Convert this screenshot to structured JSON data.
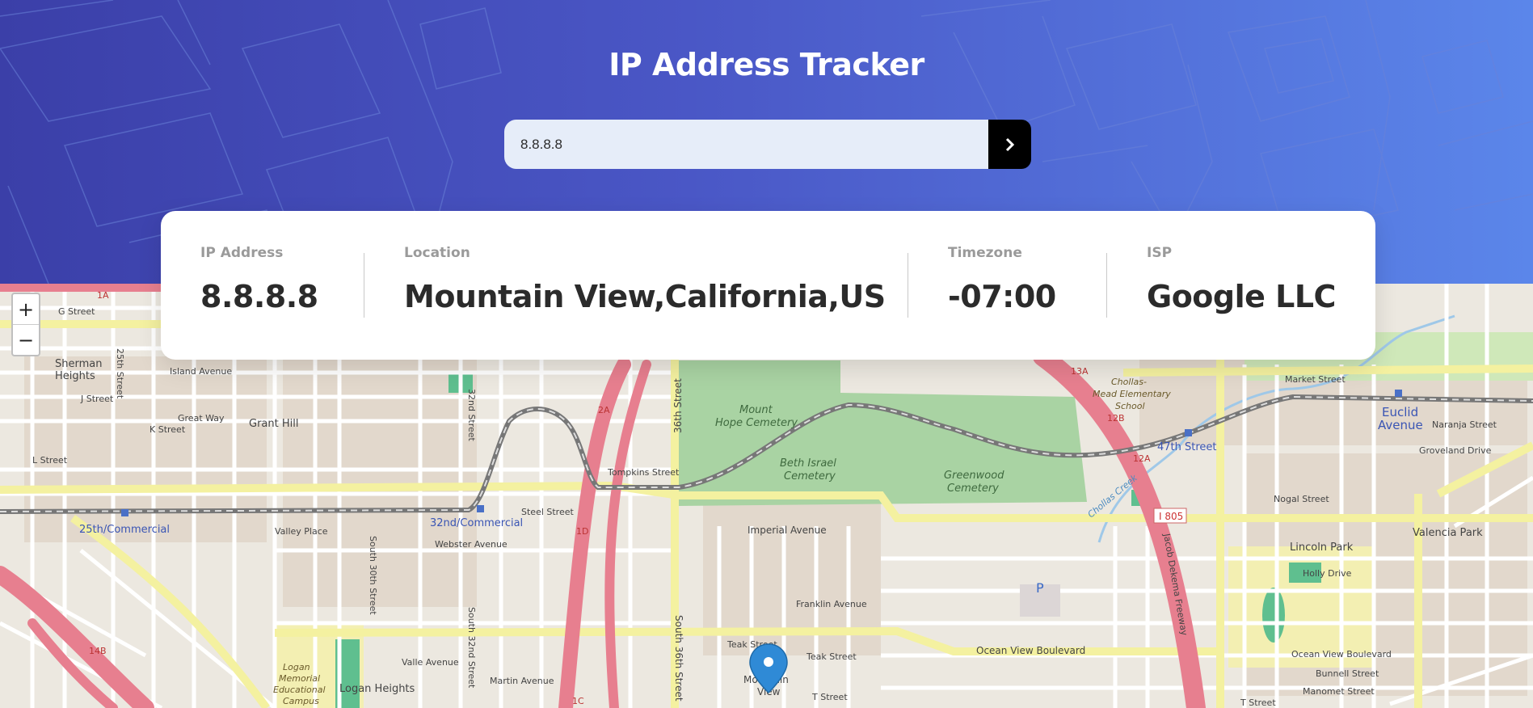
{
  "header": {
    "title": "IP Address Tracker",
    "search": {
      "value": "8.8.8.8"
    },
    "submit_icon": "chevron-right-icon"
  },
  "info": {
    "ip": {
      "label": "IP Address",
      "value": "8.8.8.8"
    },
    "location": {
      "label": "Location",
      "value": "Mountain View,California,US"
    },
    "timezone": {
      "label": "Timezone",
      "value": "-07:00"
    },
    "isp": {
      "label": "ISP",
      "value": "Google LLC"
    }
  },
  "map": {
    "zoom_in": "+",
    "zoom_out": "−",
    "marker_icon": "map-pin-icon",
    "labels": {
      "g_street": "G Street",
      "sherman": "Sherman",
      "heights": "Heights",
      "island_ave": "Island Avenue",
      "j_street": "J Street",
      "k_street": "K Street",
      "l_street": "L Street",
      "grant_hill": "Grant Hill",
      "great_way": "Great Way",
      "c25th": "25th/Commercial",
      "c32nd": "32nd/Commercial",
      "valley_place": "Valley Place",
      "webster": "Webster Avenue",
      "steel": "Steel Street",
      "tompkins": "Tompkins Street",
      "mount_hope1": "Mount",
      "mount_hope2": "Hope Cemetery",
      "beth1": "Beth Israel",
      "beth2": "Cemetery",
      "greenwood1": "Greenwood",
      "greenwood2": "Cemetery",
      "chollas1": "Chollas-",
      "chollas2": "Mead Elementary",
      "chollas3": "School",
      "market": "Market Street",
      "euclid1": "Euclid",
      "euclid2": "Avenue",
      "st47": "47th Street",
      "naranja": "Naranja Street",
      "groveland": "Groveland Drive",
      "nogal": "Nogal Street",
      "valencia": "Valencia Park",
      "lincoln": "Lincoln Park",
      "imperial": "Imperial Avenue",
      "franklin": "Franklin Avenue",
      "teak1": "Teak Street",
      "teak2": "Teak Street",
      "ocean_view": "Ocean View Boulevard",
      "ocean_view2": "Ocean View Boulevard",
      "mountain1": "Mountain",
      "mountain2": "View",
      "logan_heights": "Logan Heights",
      "logan1": "Logan",
      "logan2": "Memorial",
      "logan3": "Educational",
      "logan4": "Campus",
      "martin": "Martin Avenue",
      "valle": "Valle Avenue",
      "holly": "Holly Drive",
      "bunnell": "Bunnell Street",
      "manomet": "Manomet Street",
      "t_street1": "T Street",
      "t_street2": "T Street",
      "i805": "I 805",
      "jacob": "Jacob Dekema Freeway",
      "st36": "36th Street",
      "s36": "South 36th Street",
      "s30": "South 30th Street",
      "s32": "South 32nd Street",
      "st32": "32nd Street",
      "st25": "25th Street",
      "r2a": "2A",
      "r1d": "1D",
      "r12a": "12A",
      "r12b": "12B",
      "r13a": "13A",
      "r14b": "14B",
      "r1a": "1A",
      "r1c": "1C",
      "parking": "P",
      "chollas_creek": "Chollas Creek"
    }
  }
}
